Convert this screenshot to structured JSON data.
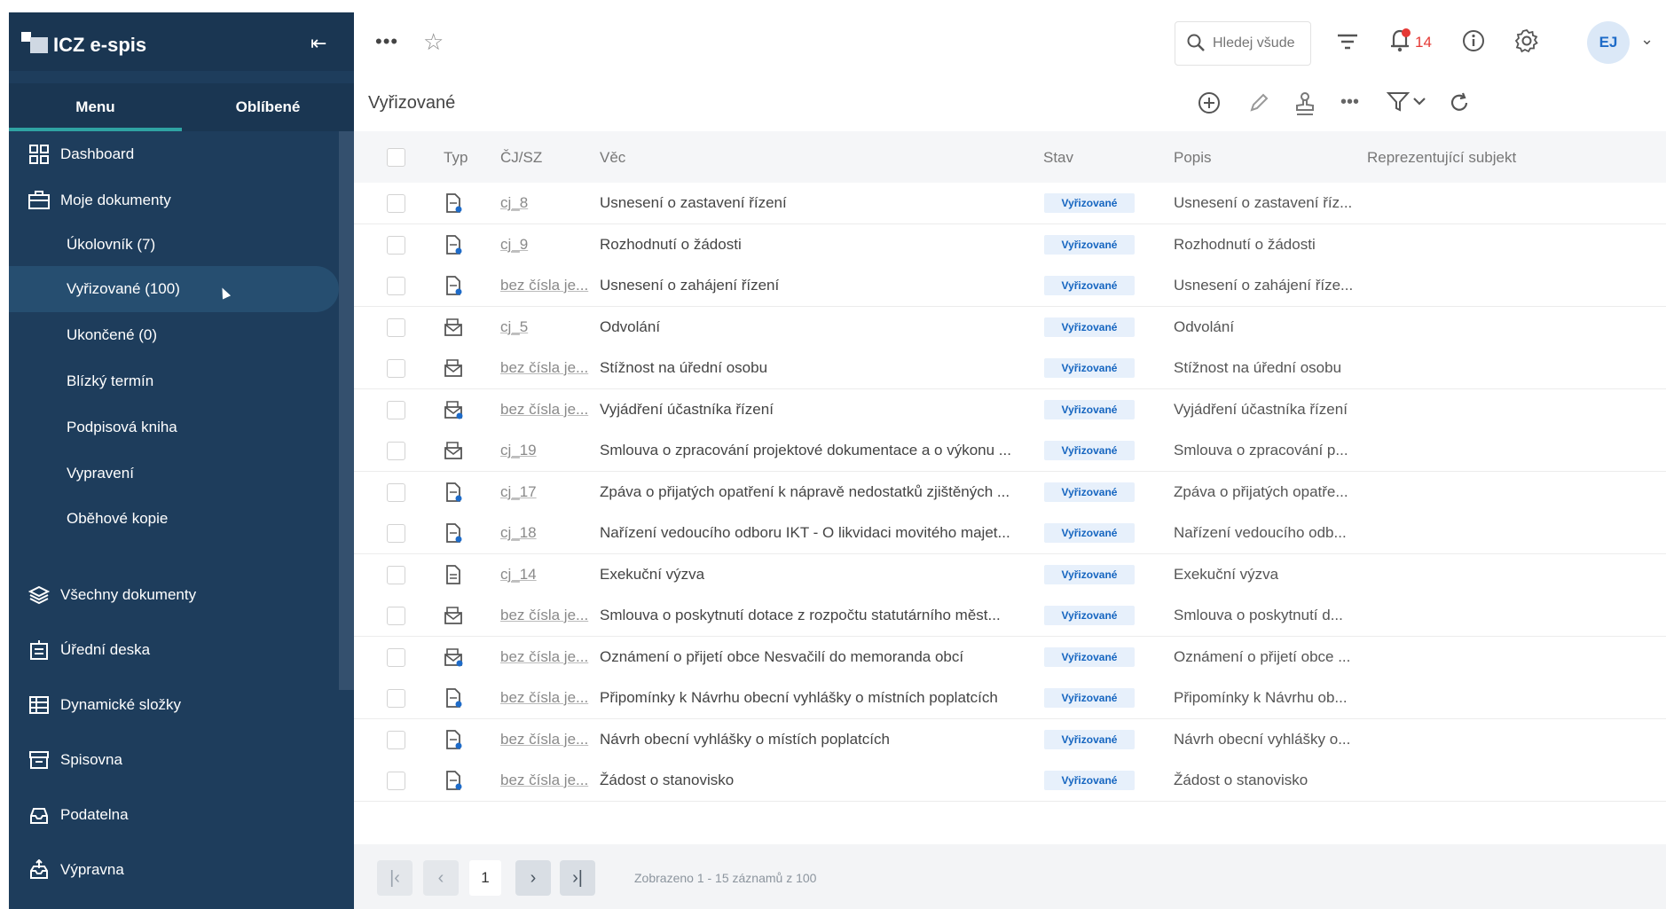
{
  "app": {
    "title": "ICZ e-spis"
  },
  "sidebar": {
    "tabs": [
      "Menu",
      "Oblíbené"
    ],
    "items": [
      {
        "label": "Dashboard",
        "icon": "dashboard-icon"
      },
      {
        "label": "Moje dokumenty",
        "icon": "briefcase-icon"
      },
      {
        "label": "Úkolovník (7)"
      },
      {
        "label": "Vyřizované (100)"
      },
      {
        "label": "Ukončené (0)"
      },
      {
        "label": "Blízký termín"
      },
      {
        "label": "Podpisová kniha"
      },
      {
        "label": "Vypravení"
      },
      {
        "label": "Oběhové kopie"
      },
      {
        "label": "Všechny dokumenty",
        "icon": "layers-icon"
      },
      {
        "label": "Úřední deska",
        "icon": "board-icon"
      },
      {
        "label": "Dynamické složky",
        "icon": "table-icon"
      },
      {
        "label": "Spisovna",
        "icon": "archive-icon"
      },
      {
        "label": "Podatelna",
        "icon": "inbox-icon"
      },
      {
        "label": "Výpravna",
        "icon": "outbox-icon"
      }
    ]
  },
  "topbar": {
    "search_placeholder": "Hledej všude",
    "notifications_count": "14",
    "avatar_initials": "EJ"
  },
  "page": {
    "title": "Vyřizované"
  },
  "table": {
    "columns": [
      "Typ",
      "ČJ/SZ",
      "Věc",
      "Stav",
      "Popis",
      "Reprezentující subjekt"
    ],
    "rows": [
      {
        "cj": "cj_8",
        "vec": "Usnesení o zastavení řízení",
        "stav": "Vyřizované",
        "popis": "Usnesení o zastavení říz..."
      },
      {
        "cj": "cj_9",
        "vec": "Rozhodnutí o žádosti",
        "stav": "Vyřizované",
        "popis": "Rozhodnutí o žádosti"
      },
      {
        "cj": "bez čísla je...",
        "vec": "Usnesení o zahájení řízení",
        "stav": "Vyřizované",
        "popis": "Usnesení o zahájení říze..."
      },
      {
        "cj": "cj_5",
        "vec": "Odvolání",
        "stav": "Vyřizované",
        "popis": "Odvolání"
      },
      {
        "cj": "bez čísla je...",
        "vec": "Stížnost na úřední osobu",
        "stav": "Vyřizované",
        "popis": "Stížnost na úřední osobu"
      },
      {
        "cj": "bez čísla je...",
        "vec": "Vyjádření účastníka řízení",
        "stav": "Vyřizované",
        "popis": "Vyjádření účastníka řízení"
      },
      {
        "cj": "cj_19",
        "vec": "Smlouva o zpracování projektové dokumentace a o výkonu ...",
        "stav": "Vyřizované",
        "popis": "Smlouva o zpracování p..."
      },
      {
        "cj": "cj_17",
        "vec": "Zpáva o přijatých opatření k nápravě nedostatků zjištěných ...",
        "stav": "Vyřizované",
        "popis": "Zpáva o přijatých opatře..."
      },
      {
        "cj": "cj_18",
        "vec": "Nařízení vedoucího odboru IKT - O likvidaci movitého majet...",
        "stav": "Vyřizované",
        "popis": "Nařízení vedoucího odb..."
      },
      {
        "cj": "cj_14",
        "vec": "Exekuční výzva",
        "stav": "Vyřizované",
        "popis": "Exekuční výzva"
      },
      {
        "cj": "bez čísla je...",
        "vec": "Smlouva o poskytnutí dotace z rozpočtu statutárního měst...",
        "stav": "Vyřizované",
        "popis": "Smlouva o poskytnutí d..."
      },
      {
        "cj": "bez čísla je...",
        "vec": "Oznámení o přijetí obce Nesvačilí do memoranda obcí",
        "stav": "Vyřizované",
        "popis": "Oznámení o přijetí obce ..."
      },
      {
        "cj": "bez čísla je...",
        "vec": "Připomínky k Návrhu obecní vyhlášky o místních poplatcích",
        "stav": "Vyřizované",
        "popis": "Připomínky k Návrhu ob..."
      },
      {
        "cj": "bez čísla je...",
        "vec": "Návrh obecní vyhlášky o místích poplatcích",
        "stav": "Vyřizované",
        "popis": "Návrh obecní vyhlášky o..."
      },
      {
        "cj": "bez čísla je...",
        "vec": "Žádost o stanovisko",
        "stav": "Vyřizované",
        "popis": "Žádost o stanovisko"
      }
    ]
  },
  "pagination": {
    "current_page": "1",
    "info": "Zobrazeno 1 - 15 záznamů z 100"
  },
  "colors": {
    "sidebar_bg": "#1e3d5c",
    "accent": "#2fa3a3",
    "status_badge_bg": "#e7f0fb",
    "status_badge_text": "#1565c0"
  }
}
